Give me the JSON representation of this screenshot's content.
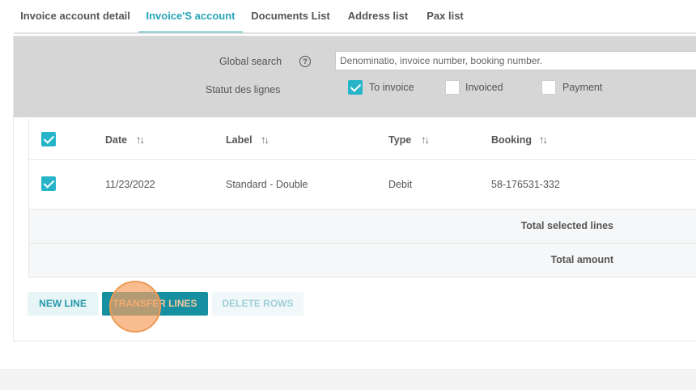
{
  "tabs": [
    {
      "label": "Invoice account detail",
      "active": false
    },
    {
      "label": "Invoice'S account",
      "active": true
    },
    {
      "label": "Documents List",
      "active": false
    },
    {
      "label": "Address list",
      "active": false
    },
    {
      "label": "Pax list",
      "active": false
    }
  ],
  "filters": {
    "global_search_label": "Global search",
    "search_placeholder": "Denominatio, invoice number, booking number.",
    "statut_label": "Statut des lignes",
    "options": [
      {
        "label": "To invoice",
        "checked": true
      },
      {
        "label": "Invoiced",
        "checked": false
      },
      {
        "label": "Payment",
        "checked": false
      }
    ]
  },
  "table": {
    "select_all_checked": true,
    "columns": [
      "Date",
      "Label",
      "Type",
      "Booking"
    ],
    "rows": [
      {
        "checked": true,
        "date": "11/23/2022",
        "label": "Standard - Double",
        "type": "Debit",
        "booking": "58-176531-332"
      }
    ],
    "footer": {
      "total_selected": "Total selected lines",
      "total_amount": "Total amount"
    }
  },
  "actions": {
    "new_line": "NEW LINE",
    "transfer_lines": "TRANSFER LINES",
    "delete_rows": "DELETE ROWS"
  },
  "icons": {
    "help": "?",
    "sort": "↑↓"
  },
  "colors": {
    "accent": "#26a5b8",
    "button_primary": "#168fa0",
    "panel": "#d6d6d6"
  }
}
